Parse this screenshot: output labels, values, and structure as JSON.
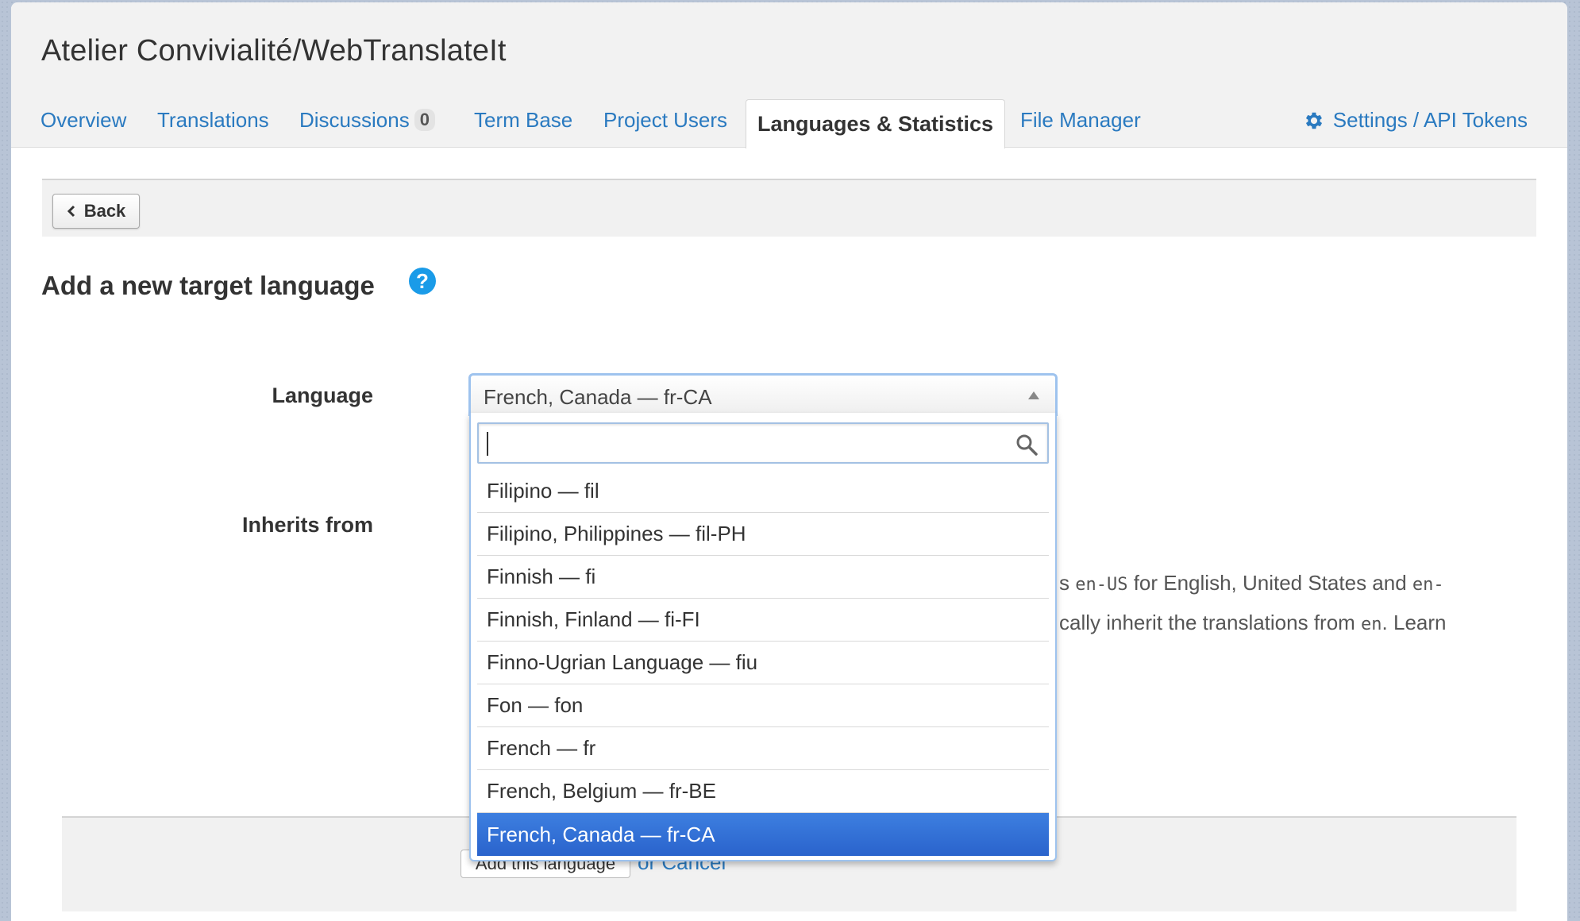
{
  "header": {
    "project_title": "Atelier Convivialité/WebTranslateIt",
    "tabs": [
      {
        "label": "Overview"
      },
      {
        "label": "Translations"
      },
      {
        "label": "Discussions",
        "badge": "0"
      },
      {
        "label": "Term Base"
      },
      {
        "label": "Project Users"
      },
      {
        "label": "Languages & Statistics",
        "active": true
      },
      {
        "label": "File Manager"
      }
    ],
    "settings_label": "Settings / API Tokens",
    "settings_icon": "gear-icon"
  },
  "toolbar": {
    "back_label": "Back"
  },
  "page": {
    "heading": "Add a new target language",
    "help_icon": "question-circle-icon"
  },
  "form": {
    "language_label": "Language",
    "language_value": "French, Canada — fr-CA",
    "inherits_label": "Inherits from",
    "hint_line1_prefix": "s ",
    "hint_line1_code1": "en-US",
    "hint_line1_mid": " for English, United States and ",
    "hint_line1_code2": "en-",
    "hint_line2_prefix": "cally inherit the translations from ",
    "hint_line2_code": "en",
    "hint_line2_suffix": ". Learn",
    "submit_label": "Add this language",
    "cancel_label": "or Cancel"
  },
  "dropdown": {
    "search_value": "",
    "options": [
      "Filipino — fil",
      "Filipino, Philippines — fil-PH",
      "Finnish — fi",
      "Finnish, Finland — fi-FI",
      "Finno-Ugrian Language — fiu",
      "Fon — fon",
      "French — fr",
      "French, Belgium — fr-BE",
      "French, Canada — fr-CA"
    ],
    "selected_index": 8
  },
  "colors": {
    "link": "#2a7ac0",
    "selected_option": "#2a63cc",
    "focus_border": "#9ec3ee"
  }
}
